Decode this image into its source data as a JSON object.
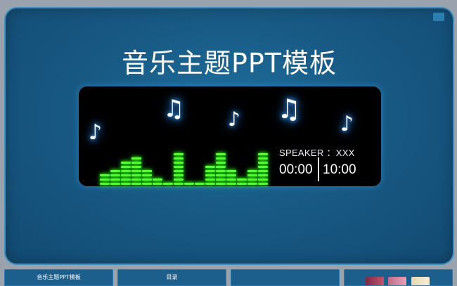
{
  "slide": {
    "title": "音乐主题PPT模板",
    "speaker_label": "SPEAKER ：XXX",
    "time_elapsed": "00:00",
    "time_total": "10:00",
    "notes": [
      "♪",
      "♫",
      "♪",
      "♫",
      "♪"
    ],
    "equalizer_levels": [
      3,
      4,
      6,
      7,
      4,
      2,
      1,
      8,
      1,
      1,
      5,
      8,
      4,
      2,
      4,
      8
    ],
    "colors": {
      "background": "#185a85",
      "panel": "#000000",
      "equalizer": "#5cff3a",
      "note_glow": "#3aa0ff"
    }
  },
  "thumbnails": [
    {
      "label": "音乐主题PPT模板"
    },
    {
      "label": "目录"
    },
    {
      "label": ""
    },
    {
      "label": ""
    }
  ]
}
